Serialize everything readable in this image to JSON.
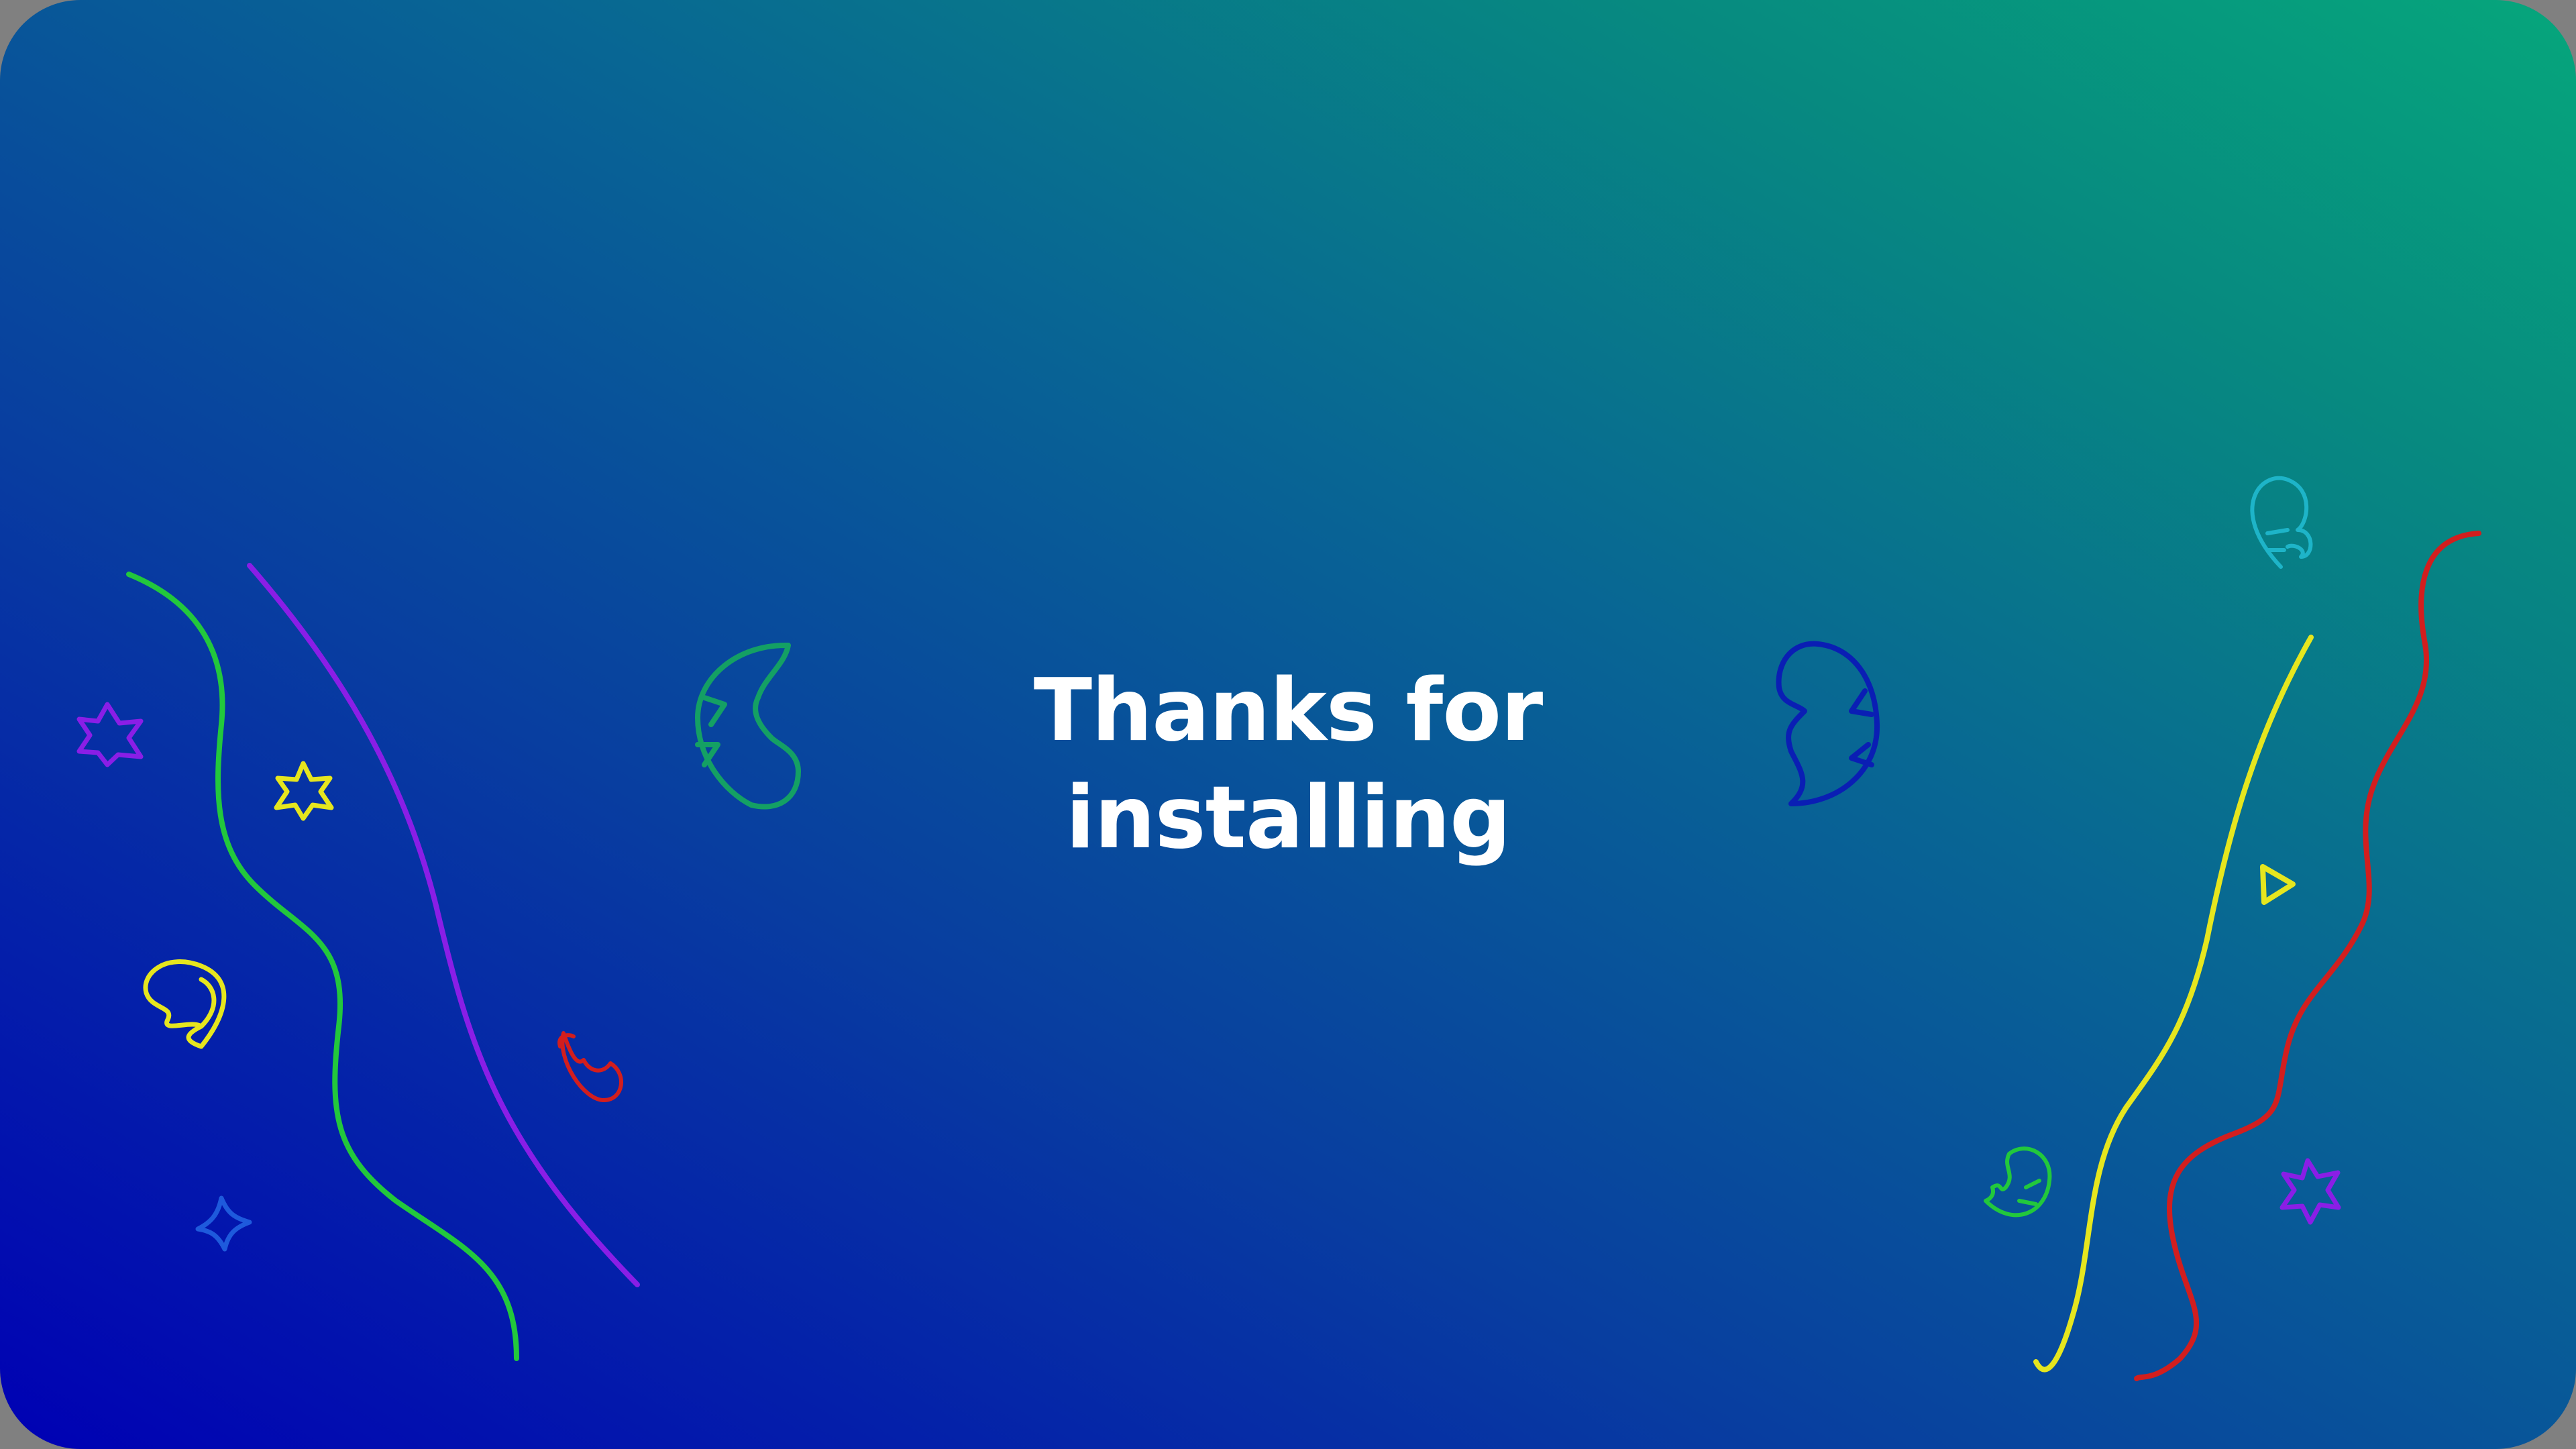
{
  "message": {
    "title": "Thanks for installing"
  },
  "colors": {
    "gradient_start": "#0000b4",
    "gradient_end": "#06a67c",
    "green": "#22c83c",
    "purple": "#8a1ee6",
    "yellow": "#e6e61e",
    "red": "#d21e1e",
    "blue": "#1e5adc",
    "cyan": "#1eb4c8",
    "teal_green": "#14a064",
    "navy": "#0a1eb4",
    "title_text": "#ffffff"
  },
  "decorations": [
    "squiggle-line",
    "star-icon",
    "leaf-icon",
    "triangle-icon",
    "sparkle-icon"
  ]
}
